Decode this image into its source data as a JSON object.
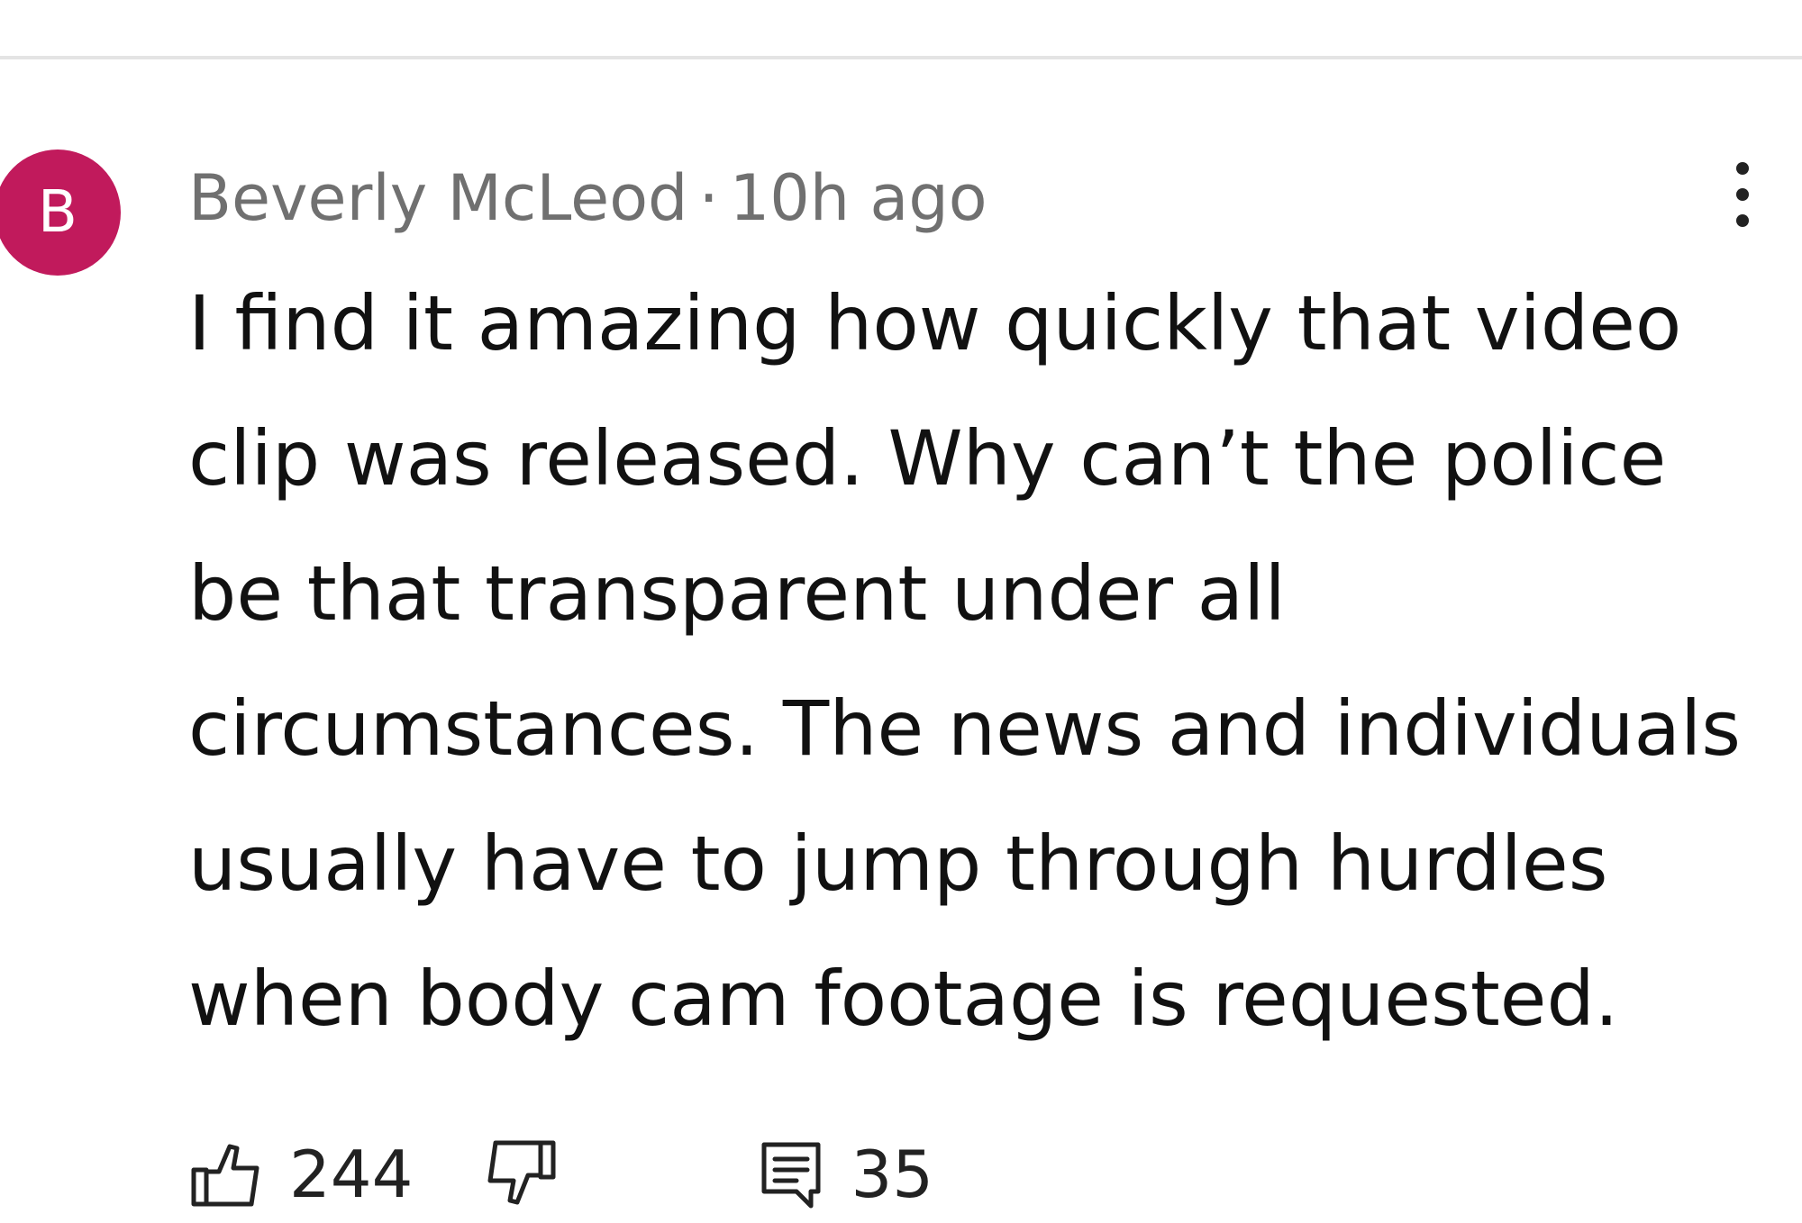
{
  "comment": {
    "avatar_letter": "B",
    "avatar_color": "#c11a5c",
    "author": "Beverly McLeod",
    "separator": "·",
    "time": "10h ago",
    "text": "I find it amazing how quickly that video\nclip was released.  Why can’t the police\nbe that transparent under all\ncircumstances.  The news and individuals\nusually have to jump through hurdles\nwhen body cam footage is requested.",
    "likes": "244",
    "replies": "35",
    "icons": {
      "more": "more-vertical-icon",
      "like": "thumbs-up-icon",
      "dislike": "thumbs-down-icon",
      "reply": "comment-icon"
    }
  }
}
